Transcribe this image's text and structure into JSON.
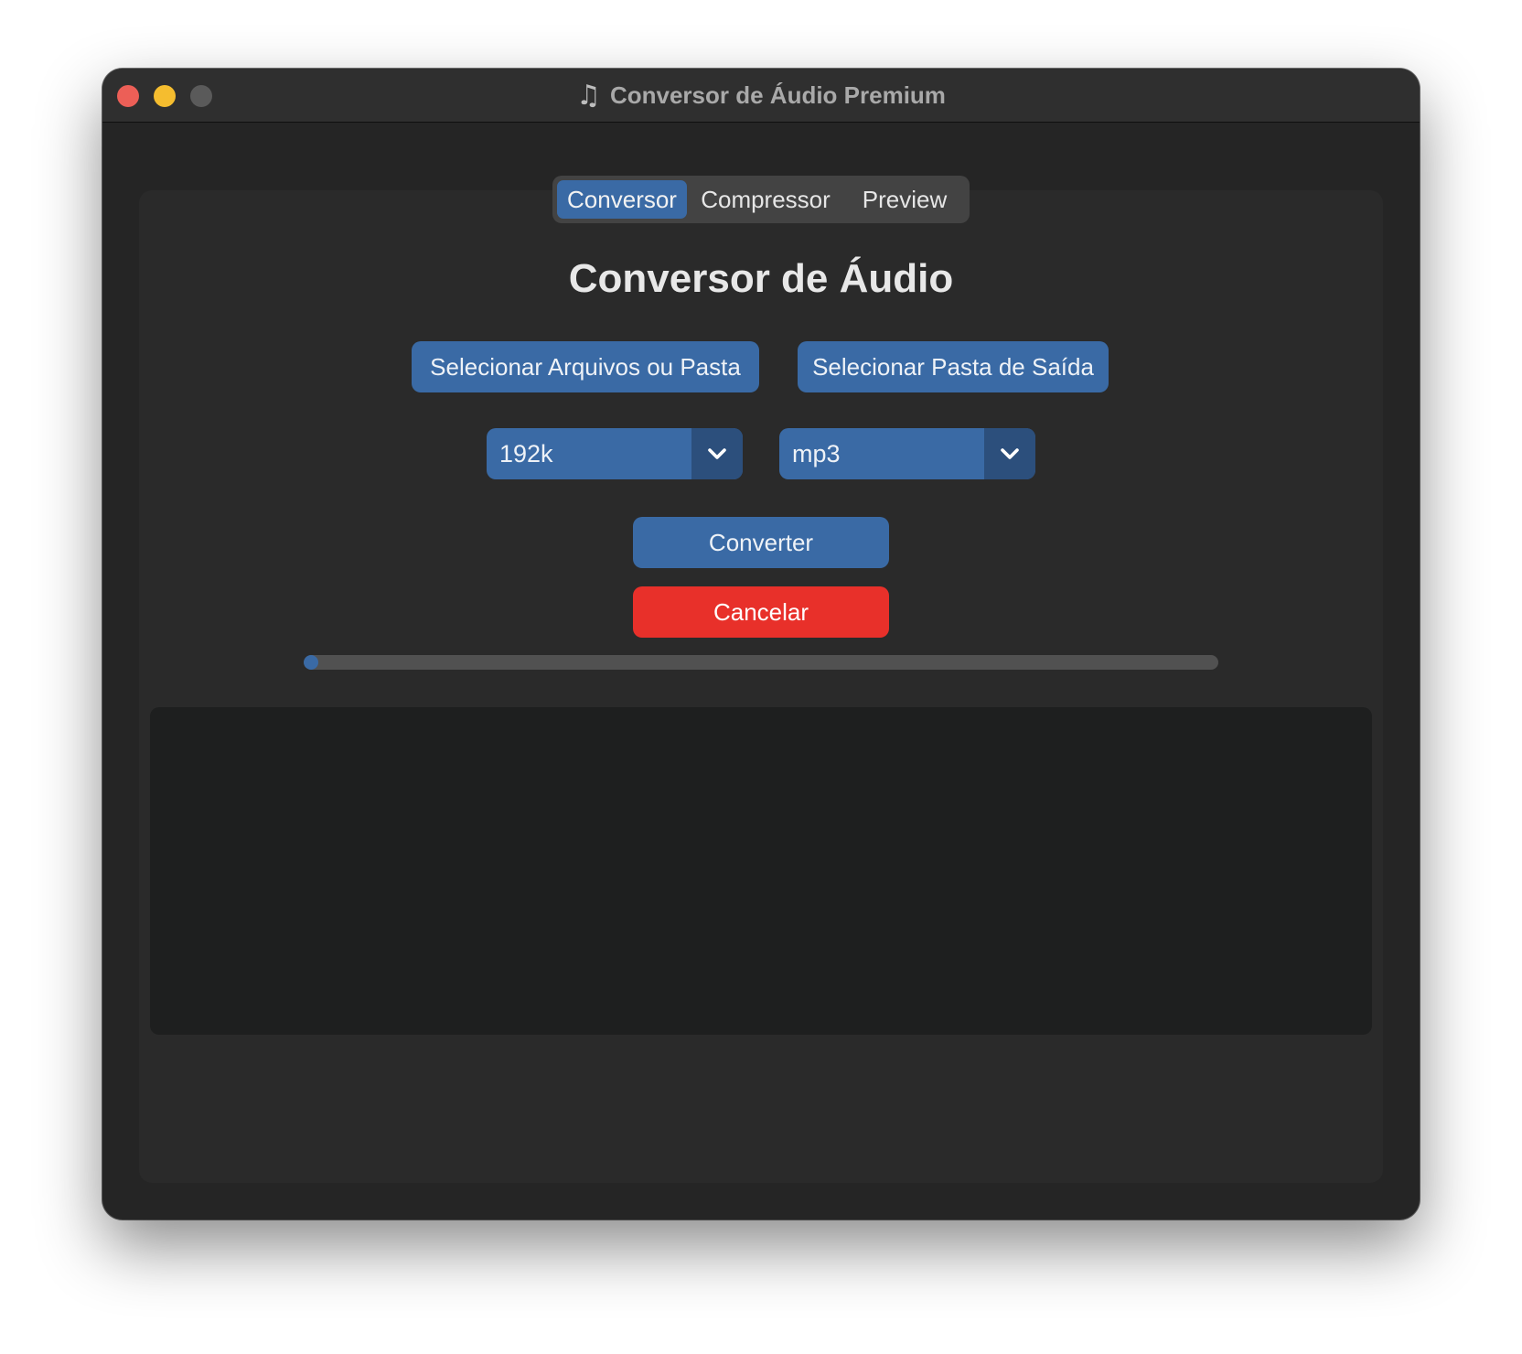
{
  "window": {
    "title_icon": "♫",
    "title": "Conversor de Áudio Premium"
  },
  "tabs": [
    {
      "label": "Conversor",
      "active": true
    },
    {
      "label": "Compressor",
      "active": false
    },
    {
      "label": "Preview",
      "active": false
    }
  ],
  "main": {
    "heading": "Conversor de Áudio",
    "select_files_label": "Selecionar Arquivos ou Pasta",
    "select_output_label": "Selecionar Pasta de Saída",
    "bitrate_value": "192k",
    "format_value": "mp3",
    "convert_label": "Converter",
    "cancel_label": "Cancelar",
    "progress_percent": 0,
    "log_text": ""
  },
  "colors": {
    "accent": "#3a6aa5",
    "accent_dark": "#2c4f7c",
    "cancel": "#e8302a",
    "window_bg": "#252525",
    "panel_bg": "#2a2a2a",
    "log_bg": "#1e1f1f"
  },
  "icons": {
    "title": "music-note-icon",
    "dropdown": "chevron-down-icon"
  }
}
